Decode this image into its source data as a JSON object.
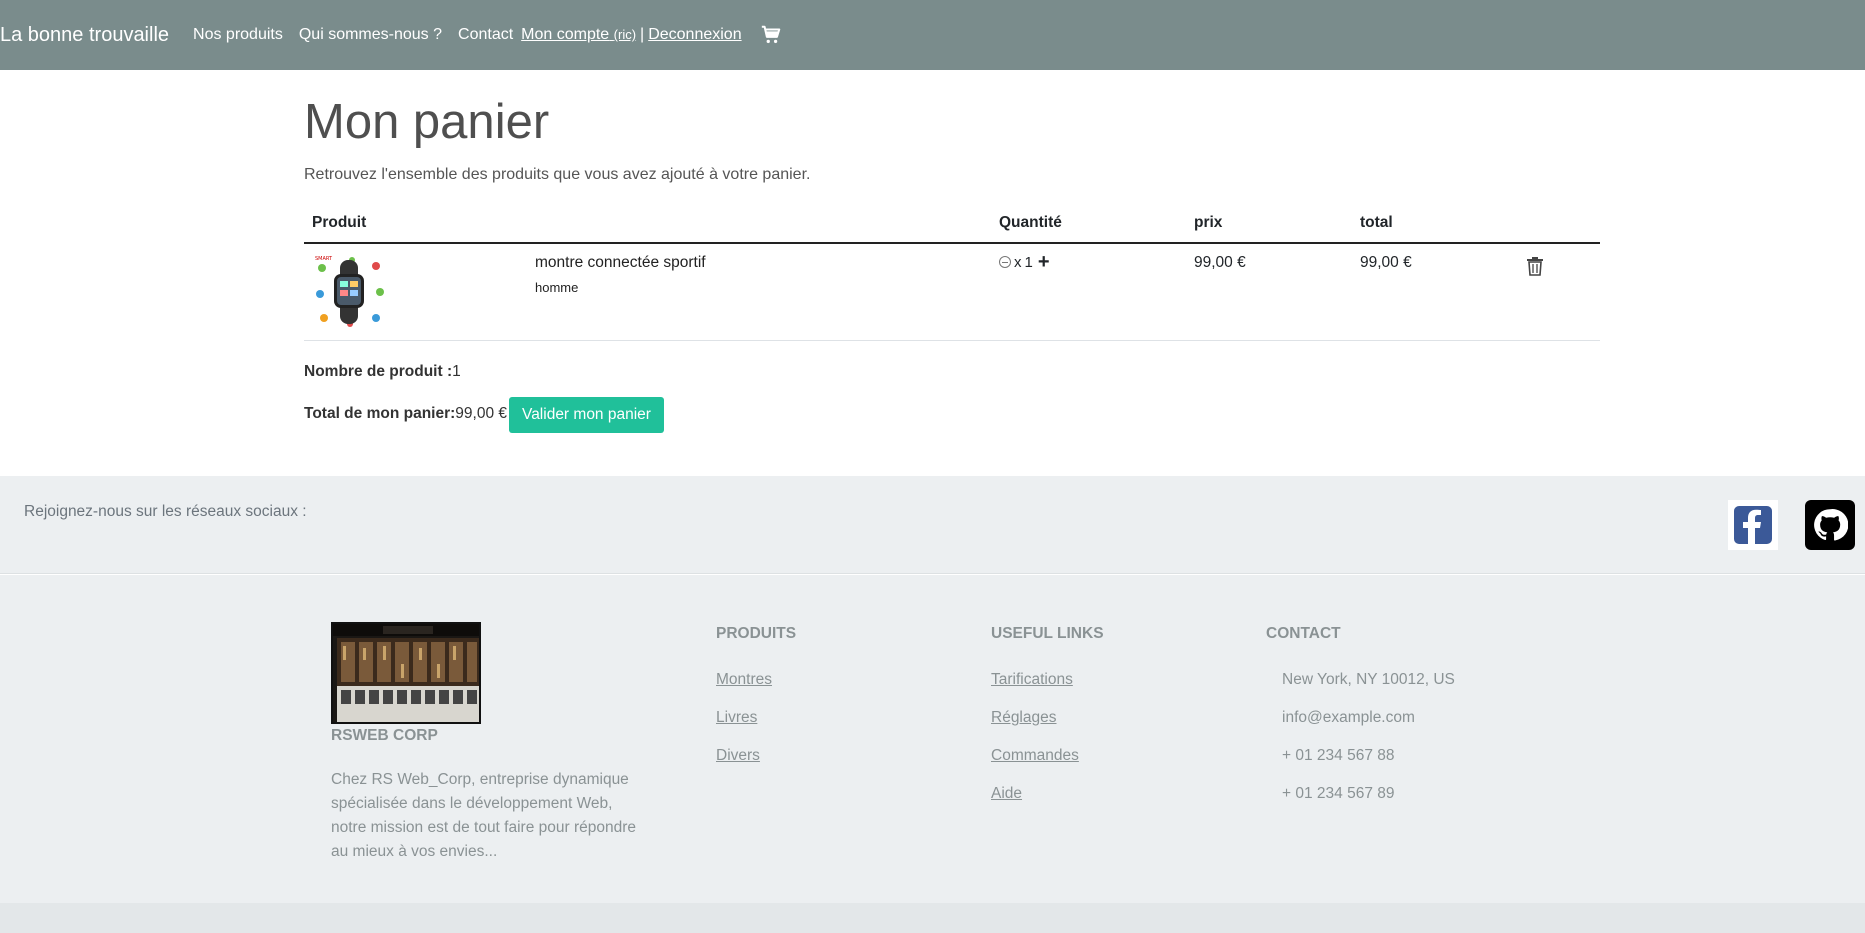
{
  "navbar": {
    "brand": "La bonne trouvaille",
    "links": [
      "Nos produits",
      "Qui sommes-nous ?",
      "Contact"
    ],
    "account_label": "Mon compte",
    "account_user": "(ric)",
    "separator": "|",
    "logout": "Deconnexion",
    "cart_icon": "cart-icon"
  },
  "page": {
    "title": "Mon panier",
    "subtitle": "Retrouvez l'ensemble des produits que vous avez ajouté à votre panier."
  },
  "cart": {
    "headers": {
      "product": "Produit",
      "quantity": "Quantité",
      "price": "prix",
      "total": "total"
    },
    "rows": [
      {
        "name": "montre connectée sportif",
        "category": "homme",
        "quantity_prefix": "x",
        "quantity": "1",
        "price": "99,00 €",
        "total": "99,00 €"
      }
    ]
  },
  "summary": {
    "count_label": "Nombre de produit :",
    "count_value": "1",
    "total_label": "Total de mon panier:",
    "total_value": "99,00 €",
    "validate_button": "Valider mon panier"
  },
  "social": {
    "text": "Rejoignez-nous sur les réseaux sociaux :",
    "icons": [
      "facebook-icon",
      "github-icon"
    ]
  },
  "footer": {
    "company_name": "RSWEB CORP",
    "company_desc": "Chez RS Web_Corp, entreprise dynamique spécialisée dans le développement Web, notre mission est de tout faire pour répondre au mieux à vos envies...",
    "products": {
      "title": "Produits",
      "links": [
        "Montres",
        "Livres",
        "Divers"
      ]
    },
    "useful": {
      "title": "Useful links",
      "links": [
        "Tarifications",
        "Réglages",
        "Commandes",
        "Aide"
      ]
    },
    "contact": {
      "title": "Contact",
      "items": [
        "New York, NY 10012, US",
        "info@example.com",
        "+ 01 234 567 88",
        "+ 01 234 567 89"
      ]
    }
  },
  "colors": {
    "navbar_bg": "#7a8c8c",
    "button_bg": "#20c09a",
    "footer_bg": "#eceff1"
  }
}
